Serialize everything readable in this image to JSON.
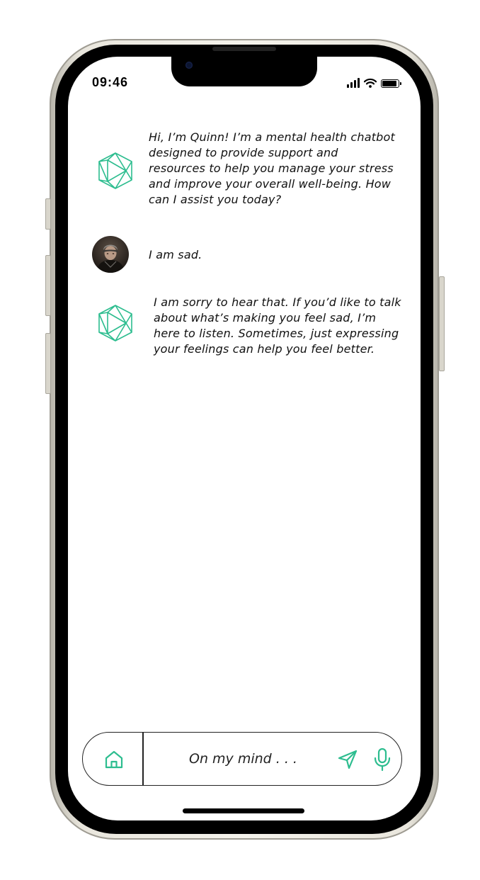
{
  "status_bar": {
    "time": "09:46",
    "signal_icon": "cellular-signal-icon",
    "wifi_icon": "wifi-icon",
    "battery_icon": "battery-icon",
    "battery_level": 0.9
  },
  "chat": {
    "messages": [
      {
        "sender": "bot",
        "avatar_icon": "icosahedron-bot-icon",
        "text": "Hi, I’m Quinn! I’m a mental health chatbot designed to provide support and resources to help you manage your stress and improve your overall well-being. How can I assist you today?",
        "lines": [
          "Hi, I’m Quinn! I’m a mental health chatbot",
          "designed to provide support and",
          "resources to help you manage your stress",
          "and improve your overall well-being. How",
          "can I assist you today?"
        ]
      },
      {
        "sender": "user",
        "avatar_icon": "user-avatar",
        "text": "I am sad."
      },
      {
        "sender": "bot",
        "avatar_icon": "icosahedron-bot-icon",
        "text": "I am sorry to hear that. If you’d like to talk about what’s making you feel sad, I’m here to listen. Sometimes, just expressing your feelings can help you feel better.",
        "lines": [
          "I am sorry to hear that. If you’d like to talk",
          "about what’s making you feel sad, I’m",
          "here to listen. Sometimes, just expressing",
          "your feelings can help you feel better."
        ]
      }
    ]
  },
  "composer": {
    "placeholder": "On my mind . . .",
    "value": "",
    "home_icon": "home-icon",
    "send_icon": "send-icon",
    "mic_icon": "microphone-icon"
  },
  "colors": {
    "accent": "#2dbd8f",
    "text": "#111111",
    "frame": "#e9e6dd"
  }
}
